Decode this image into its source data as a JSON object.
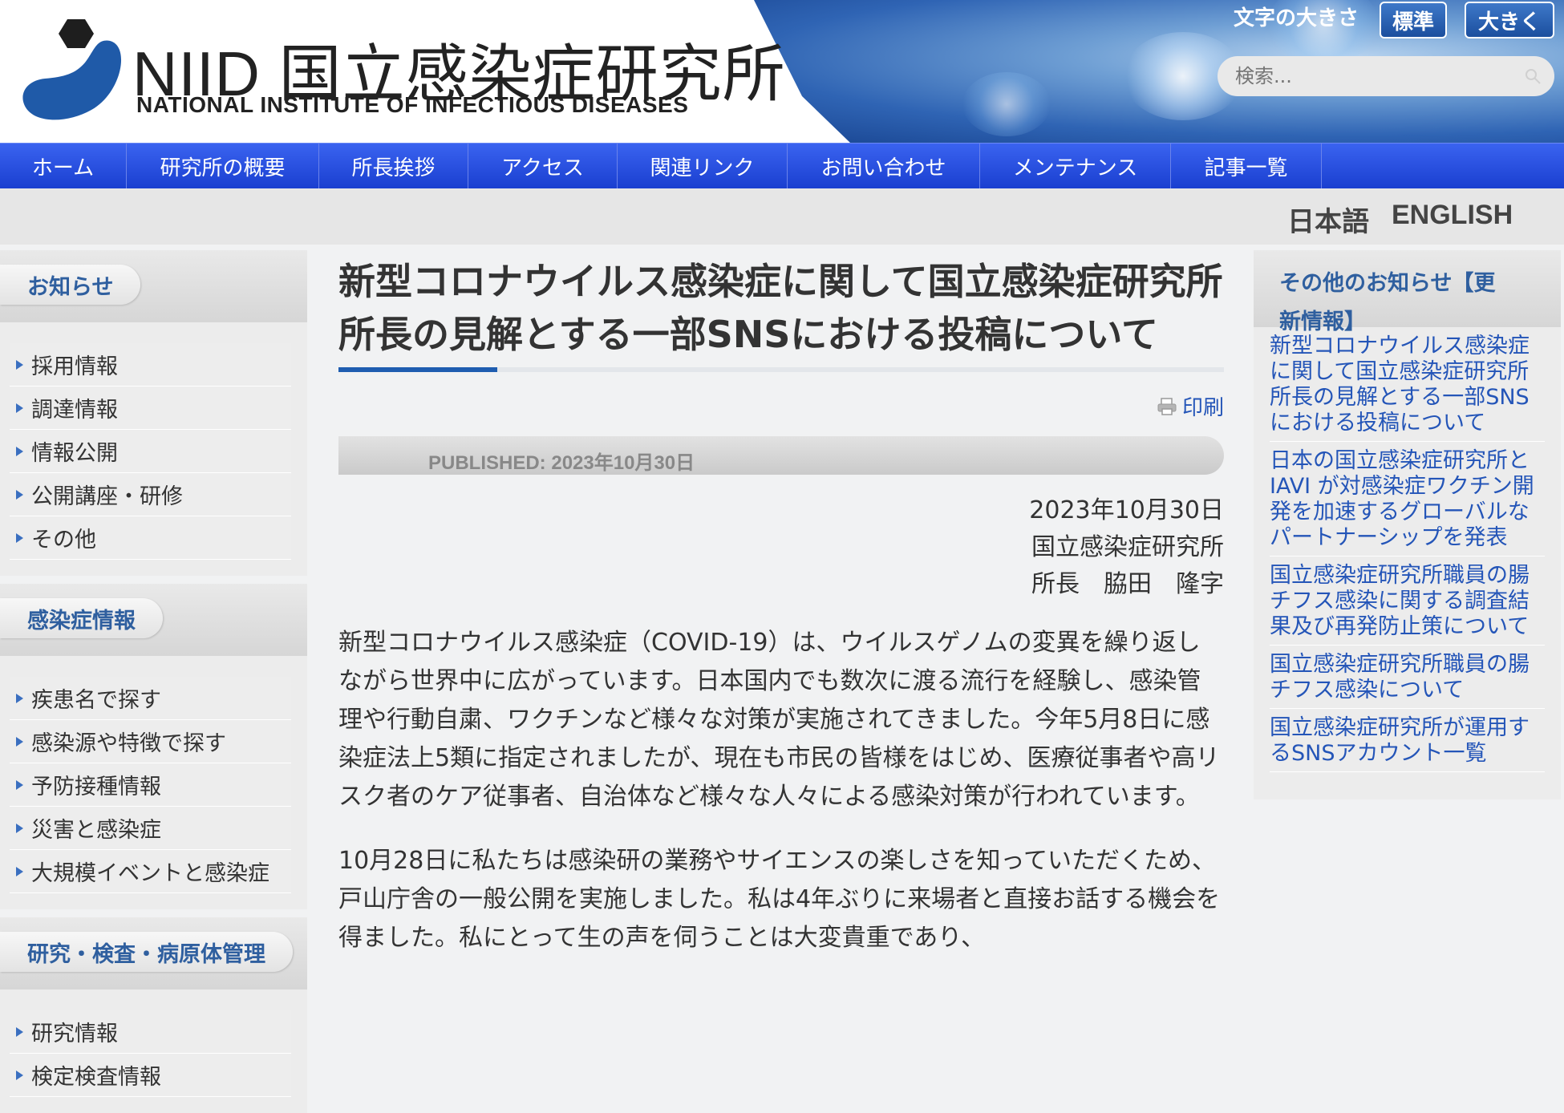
{
  "header": {
    "title_ja": "NIID 国立感染症研究所",
    "title_en": "NATIONAL INSTITUTE OF INFECTIOUS DISEASES",
    "font_size_label": "文字の大きさ",
    "font_standard": "標準",
    "font_large": "大きく",
    "search_placeholder": "検索..."
  },
  "nav": [
    {
      "label": "ホーム",
      "width": 158
    },
    {
      "label": "研究所の概要",
      "width": 240
    },
    {
      "label": "所長挨拶",
      "width": 186
    },
    {
      "label": "アクセス",
      "width": 186
    },
    {
      "label": "関連リンク",
      "width": 212
    },
    {
      "label": "お問い合わせ",
      "width": 240
    },
    {
      "label": "メンテナンス",
      "width": 238
    },
    {
      "label": "記事一覧",
      "width": 188
    }
  ],
  "languages": {
    "ja": "日本語",
    "en": "ENGLISH"
  },
  "left_sidebar": {
    "sections": [
      {
        "title": "お知らせ",
        "items": [
          "採用情報",
          "調達情報",
          "情報公開",
          "公開講座・研修",
          "その他"
        ]
      },
      {
        "title": "感染症情報",
        "items": [
          "疾患名で探す",
          "感染源や特徴で探す",
          "予防接種情報",
          "災害と感染症",
          "大規模イベントと感染症"
        ]
      },
      {
        "title": "研究・検査・病原体管理",
        "items": [
          "研究情報",
          "検定検査情報"
        ]
      }
    ]
  },
  "article": {
    "title": "新型コロナウイルス感染症に関して国立感染症研究所所長の見解とする一部SNSにおける投稿について",
    "print_label": "印刷",
    "published": "PUBLISHED: 2023年10月30日",
    "signature": [
      "2023年10月30日",
      "国立感染症研究所",
      "所長　脇田　隆字"
    ],
    "paragraphs": [
      "新型コロナウイルス感染症（COVID-19）は、ウイルスゲノムの変異を繰り返しながら世界中に広がっています。日本国内でも数次に渡る流行を経験し、感染管理や行動自粛、ワクチンなど様々な対策が実施されてきました。今年5月8日に感染症法上5類に指定されましたが、現在も市民の皆様をはじめ、医療従事者や高リスク者のケア従事者、自治体など様々な人々による感染対策が行われています。",
      "10月28日に私たちは感染研の業務やサイエンスの楽しさを知っていただくため、戸山庁舎の一般公開を実施しました。私は4年ぶりに来場者と直接お話する機会を得ました。私にとって生の声を伺うことは大変貴重であり、"
    ]
  },
  "right_sidebar": {
    "title": "その他のお知らせ【更新情報】",
    "items": [
      "新型コロナウイルス感染症に関して国立感染症研究所所長の見解とする一部SNSにおける投稿について",
      "日本の国立感染症研究所とIAVI が対感染症ワクチン開発を加速するグローバルなパートナーシップを発表",
      "国立感染症研究所職員の腸チフス感染に関する調査結果及び再発防止策について",
      "国立感染症研究所職員の腸チフス感染について",
      "国立感染症研究所が運用するSNSアカウント一覧"
    ]
  },
  "colors": {
    "nav": "#2a4fe0",
    "accent": "#1f5db0",
    "link": "#2455b8",
    "section_title": "#2f5f9f"
  }
}
